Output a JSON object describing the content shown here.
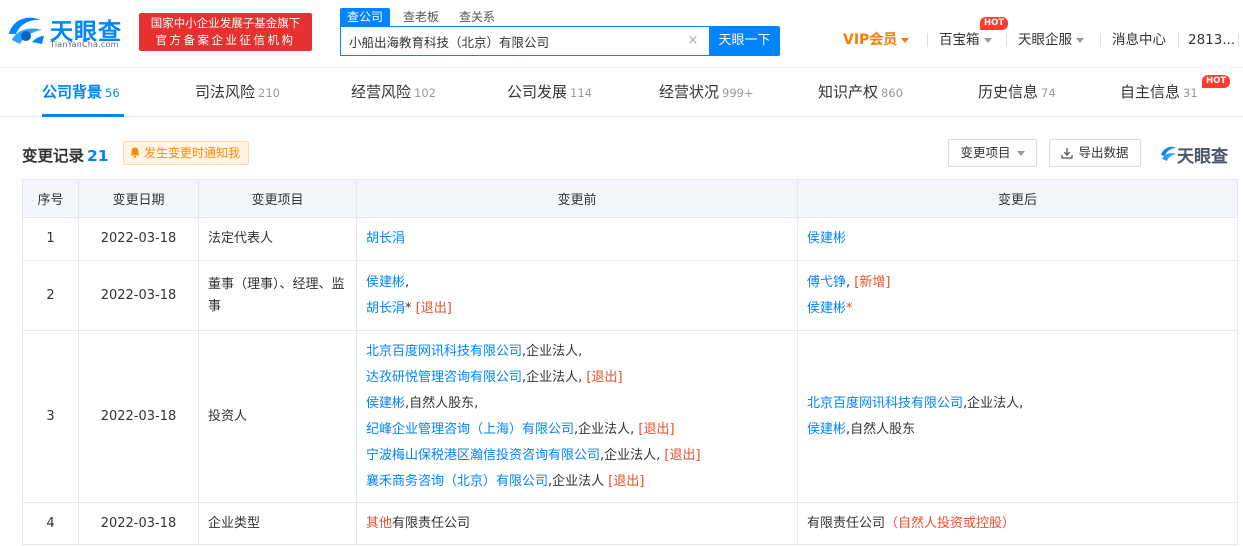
{
  "header": {
    "logo_text": "天眼查",
    "logo_sub": "TianYanCha.com",
    "badge_line1": "国家中小企业发展子基金旗下",
    "badge_line2": "官方备案企业征信机构",
    "search_tabs": [
      "查公司",
      "查老板",
      "查关系"
    ],
    "search_value": "小船出海教育科技（北京）有限公司",
    "search_button": "天眼一下",
    "vip": "VIP会员",
    "nav_baibaoxiang": "百宝箱",
    "nav_qifu": "天眼企服",
    "nav_messages": "消息中心",
    "nav_user": "2813...",
    "hot": "HOT"
  },
  "tabs": [
    {
      "label": "公司背景",
      "count": "56"
    },
    {
      "label": "司法风险",
      "count": "210"
    },
    {
      "label": "经营风险",
      "count": "102"
    },
    {
      "label": "公司发展",
      "count": "114"
    },
    {
      "label": "经营状况",
      "count": "999+"
    },
    {
      "label": "知识产权",
      "count": "860"
    },
    {
      "label": "历史信息",
      "count": "74"
    },
    {
      "label": "自主信息",
      "count": "31"
    }
  ],
  "section": {
    "title": "变更记录",
    "count": "21",
    "notify": "发生变更时通知我",
    "filter_button": "变更项目",
    "export_button": "导出数据",
    "brand": "天眼查"
  },
  "table": {
    "headers": [
      "序号",
      "变更日期",
      "变更项目",
      "变更前",
      "变更后"
    ],
    "rows": [
      {
        "no": "1",
        "date": "2022-03-18",
        "item": "法定代表人",
        "before": [
          [
            {
              "t": "胡长涓",
              "s": "link"
            }
          ]
        ],
        "after": [
          [
            {
              "t": "侯建彬",
              "s": "link"
            }
          ]
        ]
      },
      {
        "no": "2",
        "date": "2022-03-18",
        "item": "董事（理事）、经理、监事",
        "before": [
          [
            {
              "t": "侯建彬",
              "s": "link"
            },
            {
              "t": ",",
              "s": "text"
            }
          ],
          [
            {
              "t": "胡长涓",
              "s": "link"
            },
            {
              "t": "* ",
              "s": "text"
            },
            {
              "t": "[退出]",
              "s": "red"
            }
          ]
        ],
        "after": [
          [
            {
              "t": "傅弋铮",
              "s": "link"
            },
            {
              "t": ", ",
              "s": "text"
            },
            {
              "t": "[新增]",
              "s": "red"
            }
          ],
          [
            {
              "t": "侯建彬",
              "s": "link"
            },
            {
              "t": "*",
              "s": "red"
            }
          ]
        ]
      },
      {
        "no": "3",
        "date": "2022-03-18",
        "item": "投资人",
        "before": [
          [
            {
              "t": "北京百度网讯科技有限公司",
              "s": "link"
            },
            {
              "t": ",企业法人,",
              "s": "text"
            }
          ],
          [
            {
              "t": "达孜研悦管理咨询有限公司",
              "s": "link"
            },
            {
              "t": ",企业法人, ",
              "s": "text"
            },
            {
              "t": "[退出]",
              "s": "red"
            }
          ],
          [
            {
              "t": "侯建彬",
              "s": "link"
            },
            {
              "t": ",自然人股东,",
              "s": "text"
            }
          ],
          [
            {
              "t": "纪峰企业管理咨询（上海）有限公司",
              "s": "link"
            },
            {
              "t": ",企业法人, ",
              "s": "text"
            },
            {
              "t": "[退出]",
              "s": "red"
            }
          ],
          [
            {
              "t": "宁波梅山保税港区瀚信投资咨询有限公司",
              "s": "link"
            },
            {
              "t": ",企业法人, ",
              "s": "text"
            },
            {
              "t": "[退出]",
              "s": "red"
            }
          ],
          [
            {
              "t": "襄禾商务咨询（北京）有限公司",
              "s": "link"
            },
            {
              "t": ",企业法人 ",
              "s": "text"
            },
            {
              "t": "[退出]",
              "s": "red"
            }
          ]
        ],
        "after": [
          [
            {
              "t": "北京百度网讯科技有限公司",
              "s": "link"
            },
            {
              "t": ",企业法人,",
              "s": "text"
            }
          ],
          [
            {
              "t": "侯建彬",
              "s": "link"
            },
            {
              "t": ",自然人股东",
              "s": "text"
            }
          ]
        ]
      },
      {
        "no": "4",
        "date": "2022-03-18",
        "item": "企业类型",
        "before": [
          [
            {
              "t": "其他",
              "s": "red"
            },
            {
              "t": "有限责任公司",
              "s": "text"
            }
          ]
        ],
        "after": [
          [
            {
              "t": "有限责任公司",
              "s": "text"
            },
            {
              "t": "（自然人投资或控股）",
              "s": "red"
            }
          ]
        ]
      }
    ]
  },
  "colors": {
    "brand": "#0084ff",
    "badge": "#e5312f",
    "vip": "#ff7a00",
    "hot": "#ff3b30",
    "change_red": "#e8502d"
  },
  "icons": [
    "tianyancha-logo-icon",
    "clear-icon",
    "caret-down-icon",
    "bell-icon",
    "export-icon"
  ]
}
